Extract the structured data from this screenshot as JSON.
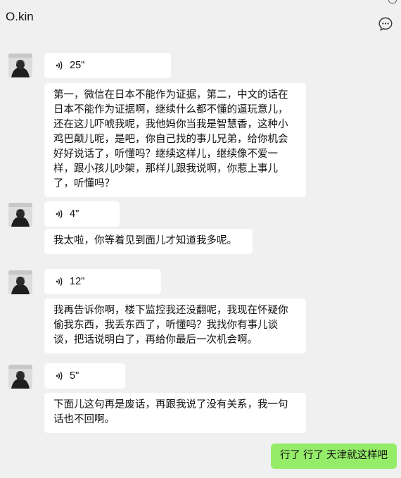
{
  "header": {
    "title": "O.kin",
    "menu_icon": "chat-more-icon"
  },
  "messages": [
    {
      "sender": "other",
      "type": "voice",
      "duration": "25\""
    },
    {
      "sender": "other",
      "type": "text",
      "text": "第一，微信在日本不能作为证据，第二，中文的话在日本不能作为证据啊，继续什么都不懂的逼玩意儿，还在这儿吓唬我呢，我他妈你当我是智慧香，这种小鸡巴颠儿呢，是吧，你自己找的事儿兄弟，给你机会好好说话了，听懂吗？继续这样儿，继续像不爱一样，跟小孩儿吵架，那样儿跟我说啊，你惹上事儿了，听懂吗？"
    },
    {
      "sender": "other",
      "type": "voice",
      "duration": "4\""
    },
    {
      "sender": "other",
      "type": "text",
      "text": "我太啦，你等着见到面儿才知道我多呢。"
    },
    {
      "sender": "other",
      "type": "voice",
      "duration": "12\""
    },
    {
      "sender": "other",
      "type": "text",
      "text": "我再告诉你啊，楼下监控我还没翻呢，我现在怀疑你偷我东西，我丢东西了，听懂吗？我找你有事儿谈谈，把话说明白了，再给你最后一次机会啊。"
    },
    {
      "sender": "other",
      "type": "voice",
      "duration": "5\""
    },
    {
      "sender": "other",
      "type": "text",
      "text": "下面儿这句再是废话，再跟我说了没有关系，我一句话也不回啊。"
    },
    {
      "sender": "self",
      "type": "text",
      "text": "行了 行了 天津就这样吧"
    }
  ]
}
